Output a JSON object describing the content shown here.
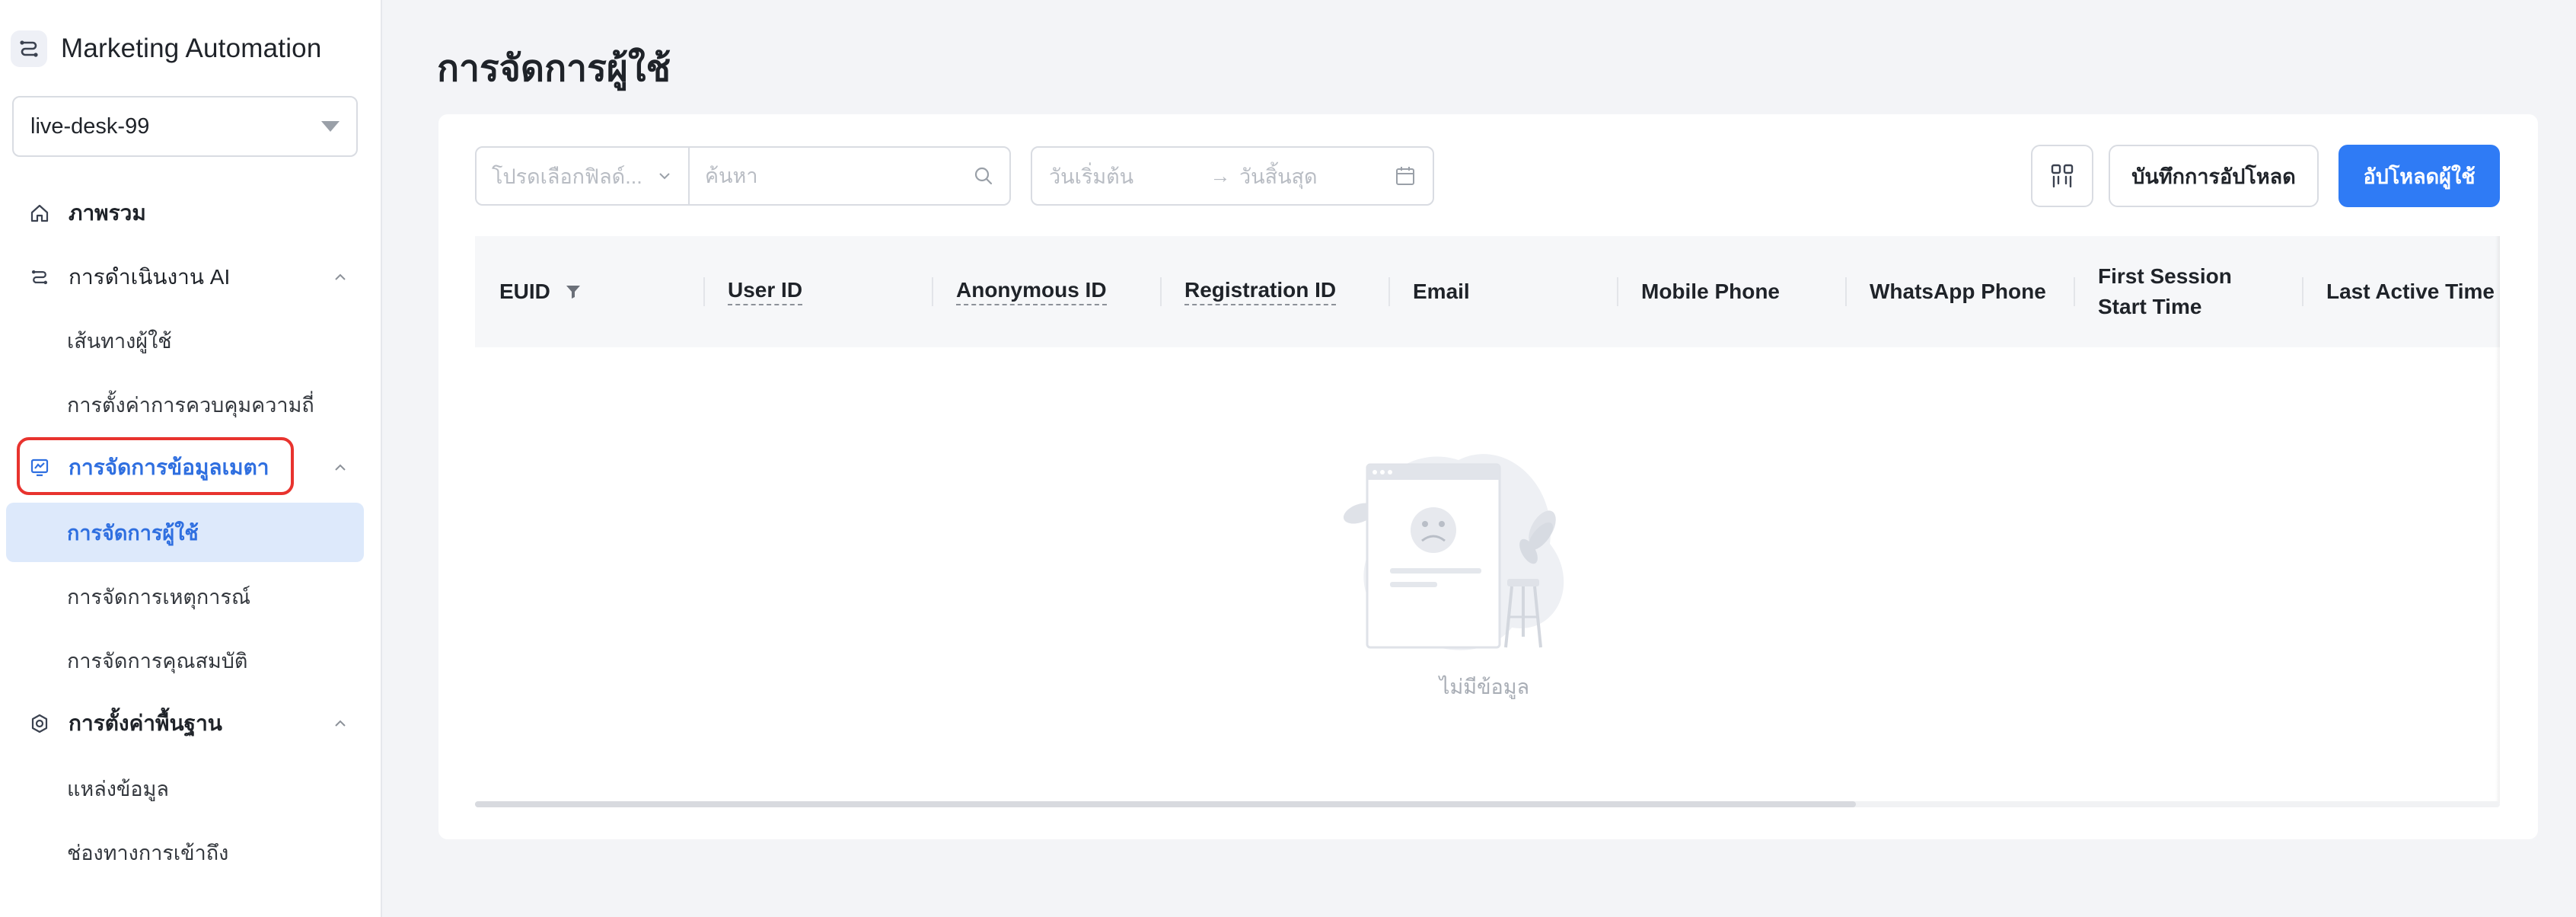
{
  "app": {
    "title": "Marketing Automation",
    "tenant": "live-desk-99"
  },
  "nav": {
    "overview": "ภาพรวม",
    "ai_ops": {
      "label": "การดำเนินงาน AI",
      "items": [
        "เส้นทางผู้ใช้",
        "การตั้งค่าการควบคุมความถี่"
      ]
    },
    "metadata": {
      "label": "การจัดการข้อมูลเมตา",
      "items": [
        "การจัดการผู้ใช้",
        "การจัดการเหตุการณ์",
        "การจัดการคุณสมบัติ"
      ]
    },
    "basic_settings": {
      "label": "การตั้งค่าพื้นฐาน",
      "items": [
        "แหล่งข้อมูล",
        "ช่องทางการเข้าถึง"
      ]
    }
  },
  "page": {
    "title": "การจัดการผู้ใช้"
  },
  "filters": {
    "field_placeholder": "โปรดเลือกฟิลด์...",
    "search_placeholder": "ค้นหา",
    "date_start": "วันเริ่มต้น",
    "date_arrow": "→",
    "date_end": "วันสิ้นสุด"
  },
  "actions": {
    "upload_history": "บันทึกการอัปโหลด",
    "upload_users": "อัปโหลดผู้ใช้"
  },
  "table": {
    "columns": [
      "EUID",
      "User ID",
      "Anonymous ID",
      "Registration ID",
      "Email",
      "Mobile Phone",
      "WhatsApp Phone",
      "First Session Start Time",
      "Last Active Time"
    ],
    "first_session_line1": "First Session",
    "first_session_line2": "Start Time",
    "empty_text": "ไม่มีข้อมูล"
  },
  "colors": {
    "accent": "#2f7bf5",
    "active_text": "#2f6fe0",
    "active_bg": "#dde9fb",
    "highlight": "#e8332e"
  }
}
